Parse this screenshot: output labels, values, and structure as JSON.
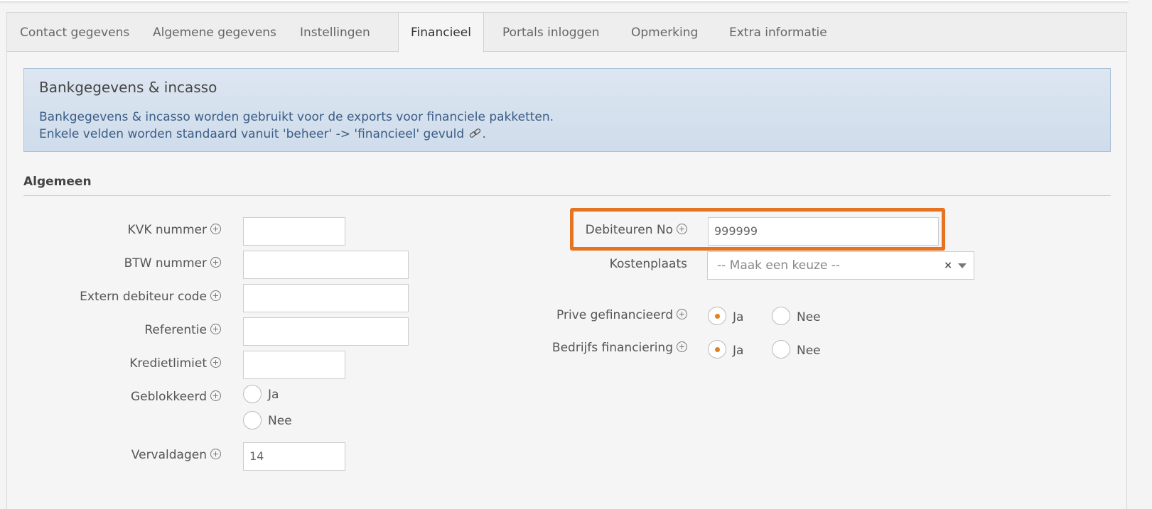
{
  "tabs": [
    {
      "label": "Contact gegevens"
    },
    {
      "label": "Algemene gegevens"
    },
    {
      "label": "Instellingen"
    },
    {
      "label": "Financieel",
      "active": true
    },
    {
      "label": "Portals inloggen"
    },
    {
      "label": "Opmerking"
    },
    {
      "label": "Extra informatie"
    }
  ],
  "info": {
    "title": "Bankgegevens & incasso",
    "line1": "Bankgegevens & incasso worden gebruikt voor de exports voor financiele pakketten.",
    "line2": "Enkele velden worden standaard vanuit 'beheer' -> 'financieel' gevuld",
    "line2_end": "."
  },
  "section": {
    "title": "Algemeen"
  },
  "left_fields": {
    "kvk": {
      "label": "KVK nummer",
      "value": ""
    },
    "btw": {
      "label": "BTW nummer",
      "value": ""
    },
    "extern": {
      "label": "Extern debiteur code",
      "value": ""
    },
    "referentie": {
      "label": "Referentie",
      "value": ""
    },
    "krediet": {
      "label": "Kredietlimiet",
      "value": ""
    },
    "geblokkeerd": {
      "label": "Geblokkeerd",
      "opt_yes": "Ja",
      "opt_no": "Nee"
    },
    "vervaldagen": {
      "label": "Vervaldagen",
      "value": "14"
    }
  },
  "right_fields": {
    "debiteuren": {
      "label": "Debiteuren No",
      "value": "999999"
    },
    "kostenplaats": {
      "label": "Kostenplaats",
      "placeholder": "-- Maak een keuze --",
      "clear": "×"
    },
    "prive": {
      "label": "Prive gefinancieerd",
      "opt_yes": "Ja",
      "opt_no": "Nee",
      "selected": "Ja"
    },
    "bedrijfs": {
      "label": "Bedrijfs financiering",
      "opt_yes": "Ja",
      "opt_no": "Nee",
      "selected": "Ja"
    }
  },
  "colors": {
    "accent": "#e67322",
    "info_text": "#3a5d86",
    "info_bg": "#dde6f1"
  }
}
